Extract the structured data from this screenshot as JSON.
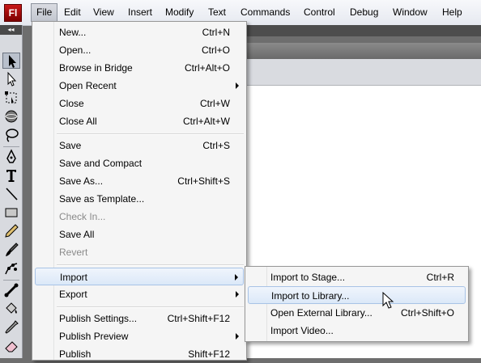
{
  "app": {
    "logo_text": "Fl"
  },
  "menubar": {
    "items": [
      "File",
      "Edit",
      "View",
      "Insert",
      "Modify",
      "Text",
      "Commands",
      "Control",
      "Debug",
      "Window",
      "Help"
    ],
    "active": "File"
  },
  "file_menu": {
    "new": {
      "label": "New...",
      "shortcut": "Ctrl+N"
    },
    "open": {
      "label": "Open...",
      "shortcut": "Ctrl+O"
    },
    "browse_bridge": {
      "label": "Browse in Bridge",
      "shortcut": "Ctrl+Alt+O"
    },
    "open_recent": {
      "label": "Open Recent"
    },
    "close": {
      "label": "Close",
      "shortcut": "Ctrl+W"
    },
    "close_all": {
      "label": "Close All",
      "shortcut": "Ctrl+Alt+W"
    },
    "save": {
      "label": "Save",
      "shortcut": "Ctrl+S"
    },
    "save_compact": {
      "label": "Save and Compact"
    },
    "save_as": {
      "label": "Save As...",
      "shortcut": "Ctrl+Shift+S"
    },
    "save_template": {
      "label": "Save as Template..."
    },
    "check_in": {
      "label": "Check In...",
      "disabled": true
    },
    "save_all": {
      "label": "Save All"
    },
    "revert": {
      "label": "Revert",
      "disabled": true
    },
    "import": {
      "label": "Import"
    },
    "export": {
      "label": "Export"
    },
    "publish_settings": {
      "label": "Publish Settings...",
      "shortcut": "Ctrl+Shift+F12"
    },
    "publish_preview": {
      "label": "Publish Preview"
    },
    "publish": {
      "label": "Publish",
      "shortcut": "Shift+F12"
    }
  },
  "import_submenu": {
    "stage": {
      "label": "Import to Stage...",
      "shortcut": "Ctrl+R"
    },
    "library": {
      "label": "Import to Library..."
    },
    "external": {
      "label": "Open External Library...",
      "shortcut": "Ctrl+Shift+O"
    },
    "video": {
      "label": "Import Video..."
    }
  },
  "tools": [
    "selection-tool",
    "subselection-tool",
    "free-transform-tool",
    "3d-rotation-tool",
    "lasso-tool",
    "pen-tool",
    "text-tool",
    "line-tool",
    "rectangle-tool",
    "pencil-tool",
    "brush-tool",
    "deco-tool",
    "bone-tool",
    "paint-bucket-tool",
    "eyedropper-tool",
    "eraser-tool"
  ],
  "colors": {
    "menu_bg": "#f5f5f5",
    "highlight": "#dbe8f8",
    "logo_red": "#b01010",
    "stage": "#ffffff"
  }
}
